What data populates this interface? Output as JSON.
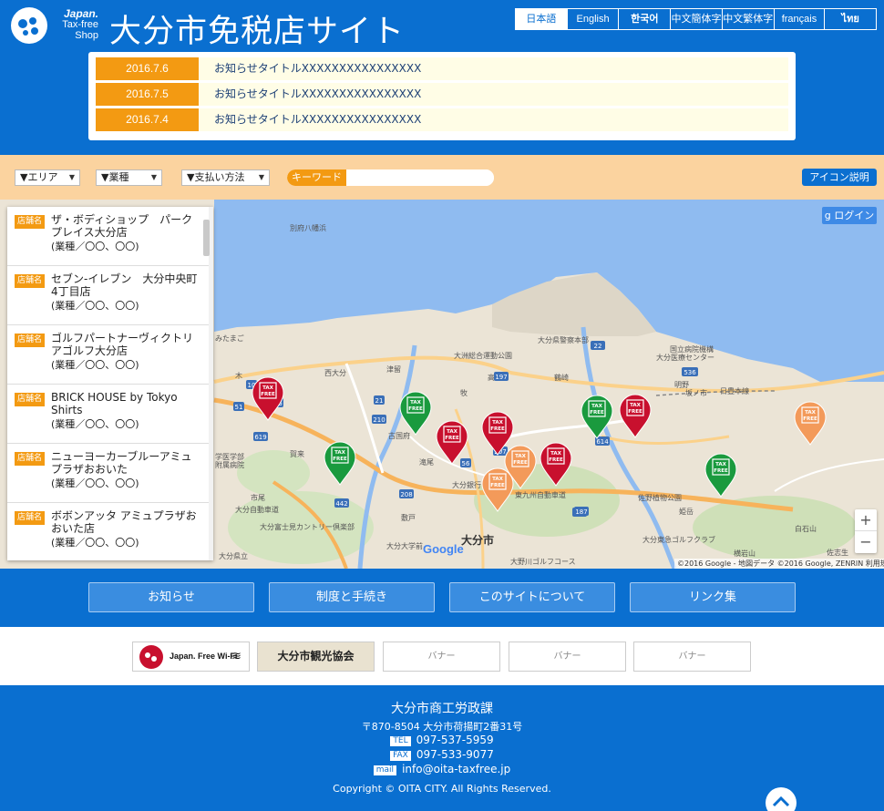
{
  "header": {
    "logo_text": [
      "Japan.",
      "Tax-free",
      "Shop"
    ],
    "site_title": "大分市免税店サイト",
    "languages": [
      {
        "label": "日本語",
        "active": true
      },
      {
        "label": "English"
      },
      {
        "label": "한국어"
      },
      {
        "label": "中文簡体字"
      },
      {
        "label": "中文繁体字"
      },
      {
        "label": "français"
      },
      {
        "label": "ไทย"
      }
    ]
  },
  "news": [
    {
      "date": "2016.7.6",
      "title": "お知らせタイトルXXXXXXXXXXXXXXXX"
    },
    {
      "date": "2016.7.5",
      "title": "お知らせタイトルXXXXXXXXXXXXXXXX"
    },
    {
      "date": "2016.7.4",
      "title": "お知らせタイトルXXXXXXXXXXXXXXXX"
    }
  ],
  "filters": {
    "area": "▼エリア",
    "category": "▼業種",
    "payment": "▼支払い方法",
    "keyword_label": "キーワード",
    "keyword_value": "",
    "icon_help": "アイコン説明"
  },
  "map": {
    "login": "ログイン",
    "zoom_in": "+",
    "zoom_out": "−",
    "attribution": "©2016 Google - 地図データ ©2016 Google, ZENRIN 利用規約",
    "google_logo": "Google",
    "labels": [
      "別府八幡浜",
      "大分県警察本部",
      "大洲総合運動公園",
      "国立病院機構",
      "大分医療センター",
      "大分市",
      "高城",
      "鶴崎",
      "坂ノ市",
      "日豊本線",
      "西大分",
      "津留",
      "牧",
      "古国府",
      "賀来",
      "滝尾",
      "大分銀行ドーム",
      "佐野植物公園",
      "大分東急ゴルフクラブ",
      "白石山",
      "横岩山",
      "佐志生",
      "敷戸",
      "大分大学前",
      "大分富士見カントリー倶楽部",
      "大野川ゴルフコース",
      "東九州自動車道",
      "大分自動車道",
      "市尾",
      "みたまご",
      "木",
      "明野",
      "姫岳",
      "大分県立",
      "学医学部",
      "附属病院"
    ],
    "road_numbers": [
      "22",
      "536",
      "197",
      "197",
      "21",
      "51",
      "619",
      "210",
      "442",
      "56",
      "614",
      "208",
      "187",
      "207",
      "696",
      "10"
    ]
  },
  "shops": [
    {
      "tag": "店舗名",
      "name": "ザ・ボディショップ　パークプレイス大分店",
      "category": "(業種／〇〇、〇〇)"
    },
    {
      "tag": "店舗名",
      "name": "セブン-イレブン　大分中央町4丁目店",
      "category": "(業種／〇〇、〇〇)"
    },
    {
      "tag": "店舗名",
      "name": "ゴルフパートナーヴィクトリアゴルフ大分店",
      "category": "(業種／〇〇、〇〇)"
    },
    {
      "tag": "店舗名",
      "name": "BRICK HOUSE by Tokyo Shirts",
      "category": "(業種／〇〇、〇〇)"
    },
    {
      "tag": "店舗名",
      "name": "ニューヨーカーブルーアミュプラザおおいた",
      "category": "(業種／〇〇、〇〇)"
    },
    {
      "tag": "店舗名",
      "name": "ボボンアッタ アミュプラザおおいた店",
      "category": "(業種／〇〇、〇〇)"
    }
  ],
  "markers": [
    {
      "type": "red",
      "text": "TAX FREE"
    },
    {
      "type": "green",
      "text": "TAX FREE"
    },
    {
      "type": "green",
      "text": "TAX FREE"
    },
    {
      "type": "red",
      "text": "TAX FREE"
    },
    {
      "type": "red",
      "text": "TAX FREE"
    },
    {
      "type": "orange",
      "text": "TAX FREE"
    },
    {
      "type": "orange",
      "text": "TAX FREE"
    },
    {
      "type": "red",
      "text": "TAX FREE"
    },
    {
      "type": "green",
      "text": "TAX FREE"
    },
    {
      "type": "red",
      "text": "TAX FREE"
    },
    {
      "type": "green",
      "text": "TAX FREE"
    },
    {
      "type": "orange",
      "text": "TAX FREE"
    }
  ],
  "nav": [
    "お知らせ",
    "制度と手続き",
    "このサイトについて",
    "リンク集"
  ],
  "banners": [
    {
      "label": "Japan. Free Wi-Fi"
    },
    {
      "label": "大分市観光協会"
    },
    {
      "label": "バナー"
    },
    {
      "label": "バナー"
    },
    {
      "label": "バナー"
    }
  ],
  "footer": {
    "org": "大分市商工労政課",
    "address": "〒870-8504 大分市荷揚町2番31号",
    "tel_tag": "TEL",
    "tel": "097-537-5959",
    "fax_tag": "FAX",
    "fax": "097-533-9077",
    "mail_tag": "mail",
    "mail": "info@oita-taxfree.jp",
    "copyright": "Copyright © OITA CITY. All Rights Reserved."
  },
  "colors": {
    "brand_blue": "#0a6fd0",
    "accent_orange": "#f39a12",
    "marker_red": "#c8102e",
    "marker_green": "#1a9a3e",
    "marker_orange": "#f39a5a"
  }
}
